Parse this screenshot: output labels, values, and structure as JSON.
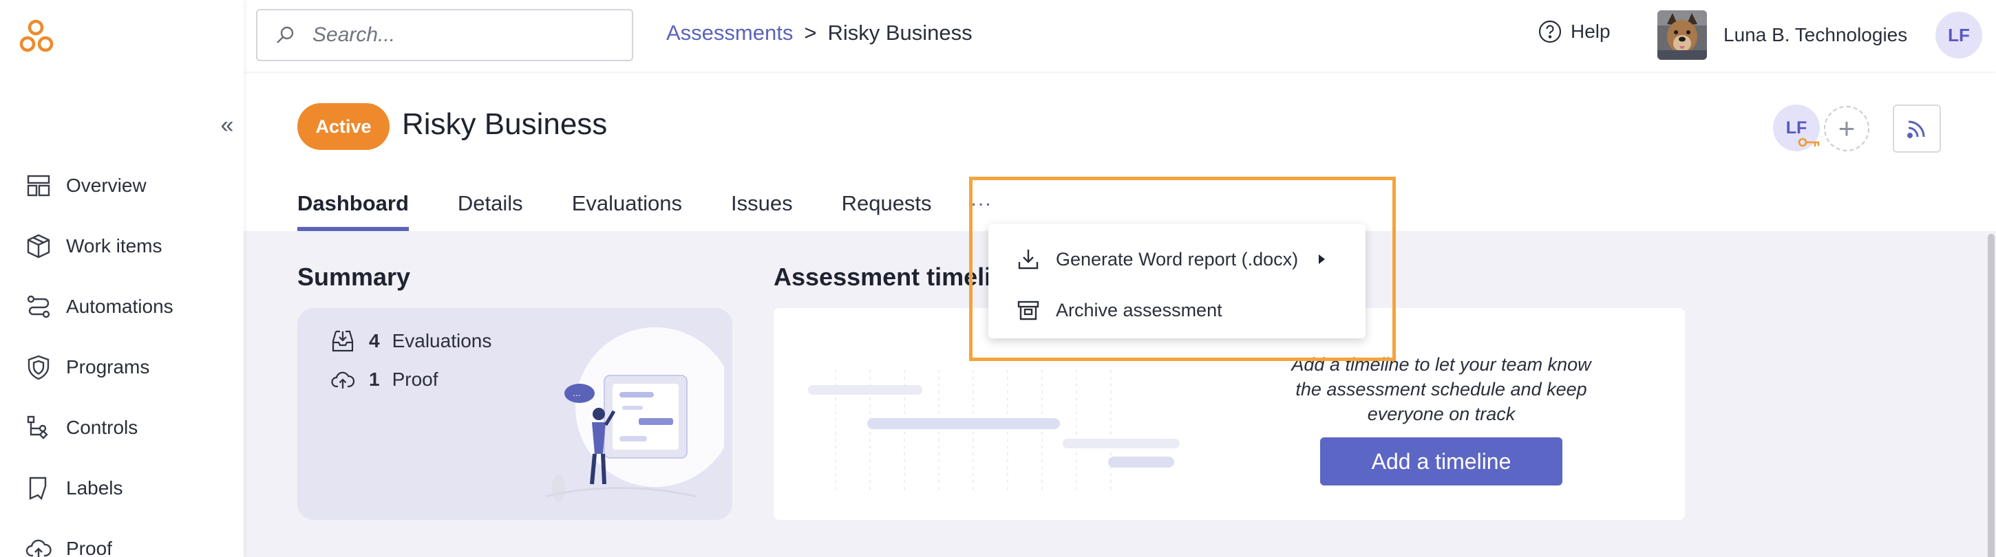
{
  "sidebar": {
    "logo_icon": "app-logo-icon",
    "collapse_glyph": "«",
    "items": [
      {
        "label": "Overview",
        "icon": "layout-icon"
      },
      {
        "label": "Work items",
        "icon": "box-icon"
      },
      {
        "label": "Automations",
        "icon": "route-icon"
      },
      {
        "label": "Programs",
        "icon": "shield-icon"
      },
      {
        "label": "Controls",
        "icon": "flow-icon"
      },
      {
        "label": "Labels",
        "icon": "bookmark-icon"
      },
      {
        "label": "Proof",
        "icon": "cloud-upload-icon"
      }
    ]
  },
  "header": {
    "search_placeholder": "Search...",
    "breadcrumb": {
      "parent": "Assessments",
      "separator": ">",
      "current": "Risky Business"
    },
    "help_label": "Help",
    "org_name": "Luna B. Technologies",
    "user_initials": "LF"
  },
  "assessment": {
    "status": "Active",
    "title": "Risky Business",
    "assignee_initials": "LF",
    "add_member_glyph": "+"
  },
  "tabs": [
    {
      "label": "Dashboard",
      "active": true
    },
    {
      "label": "Details",
      "active": false
    },
    {
      "label": "Evaluations",
      "active": false
    },
    {
      "label": "Issues",
      "active": false
    },
    {
      "label": "Requests",
      "active": false
    }
  ],
  "tabs_more": "...",
  "dropdown": {
    "items": [
      {
        "label": "Generate Word report (.docx)",
        "icon": "download-icon",
        "has_submenu": true
      },
      {
        "label": "Archive assessment",
        "icon": "archive-icon",
        "has_submenu": false
      }
    ]
  },
  "summary": {
    "title": "Summary",
    "stats": [
      {
        "count": "4",
        "label": "Evaluations",
        "icon": "inbox-download-icon"
      },
      {
        "count": "1",
        "label": "Proof",
        "icon": "cloud-upload-icon"
      }
    ]
  },
  "timeline": {
    "title": "Assessment timeline",
    "empty_text": "Add a timeline to let your team know the assessment schedule and keep everyone on track",
    "button_label": "Add a timeline"
  },
  "colors": {
    "accent": "#5a63b8",
    "status_active": "#ee8a2c",
    "highlight": "#f5a33c",
    "button": "#5c66c4"
  }
}
